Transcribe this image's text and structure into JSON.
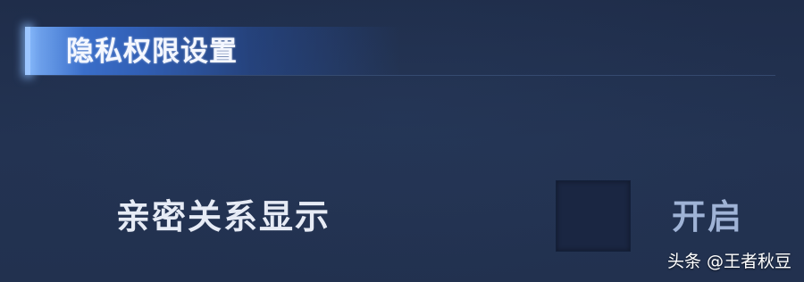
{
  "section": {
    "title": "隐私权限设置"
  },
  "settings": [
    {
      "label": "亲密关系显示",
      "status": "开启"
    }
  ],
  "watermark": {
    "text": "头条 @王者秋豆"
  },
  "colors": {
    "background": "#223150",
    "header_accent": "#4682e6",
    "toggle_box": "#1a2642",
    "status_text": "#9fb3d6"
  }
}
